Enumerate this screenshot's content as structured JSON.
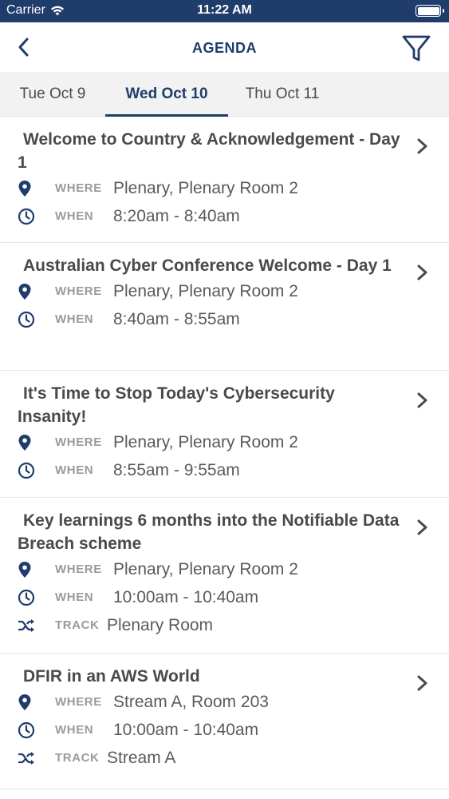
{
  "status_bar": {
    "carrier": "Carrier",
    "time": "11:22 AM"
  },
  "nav": {
    "title": "AGENDA"
  },
  "tabs": [
    {
      "label": "Tue Oct 9",
      "active": false
    },
    {
      "label": "Wed Oct 10",
      "active": true
    },
    {
      "label": "Thu Oct 11",
      "active": false
    }
  ],
  "labels": {
    "where": "WHERE",
    "when": "WHEN",
    "track": "TRACK"
  },
  "sessions": [
    {
      "title": "Welcome to Country & Acknowledgement - Day 1",
      "where": "Plenary, Plenary Room 2",
      "when": "8:20am - 8:40am"
    },
    {
      "title": "Australian Cyber Conference Welcome - Day 1",
      "where": "Plenary, Plenary Room 2",
      "when": "8:40am - 8:55am"
    },
    {
      "title": "It's Time to Stop Today's Cybersecurity Insanity!",
      "where": "Plenary, Plenary Room 2",
      "when": "8:55am - 9:55am"
    },
    {
      "title": "Key learnings 6 months into the Notifiable Data Breach scheme",
      "where": "Plenary, Plenary Room 2",
      "when": "10:00am - 10:40am",
      "track": "Plenary Room"
    },
    {
      "title": "DFIR in an AWS World",
      "where": "Stream A, Room 203",
      "when": "10:00am - 10:40am",
      "track": "Stream A"
    }
  ],
  "colors": {
    "primary": "#1f3c6b",
    "text": "#4a4a4a",
    "label": "#9a9a9a",
    "tab_bg": "#f2f2f2"
  },
  "icons": {
    "back": "chevron-left-icon",
    "filter": "filter-funnel-icon",
    "where": "map-pin-icon",
    "when": "clock-icon",
    "track": "shuffle-icon",
    "row": "chevron-right-icon"
  }
}
